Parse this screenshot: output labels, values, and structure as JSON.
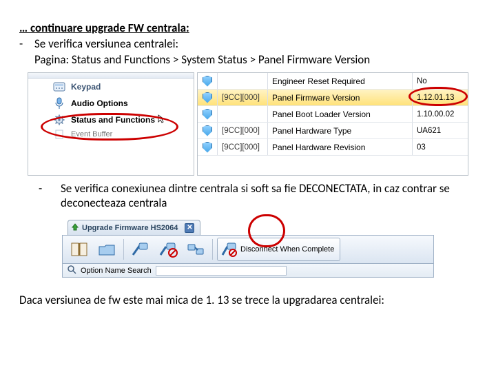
{
  "heading": "… continuare  upgrade FW centrala:",
  "line1": "Se verifica versiunea centralei:",
  "line2": "Pagina: Status and Functions > System Status > Panel Firmware Version",
  "tree": {
    "items": [
      {
        "label": "Keypad"
      },
      {
        "label": "Audio Options"
      },
      {
        "label": "Status and Functions"
      },
      {
        "label": "Event Buffer"
      }
    ]
  },
  "table": {
    "rows": [
      {
        "code": "",
        "label": "Engineer Reset Required",
        "value": "No"
      },
      {
        "code": "[9CC][000]",
        "label": "Panel Firmware Version",
        "value": "1.12.01.13"
      },
      {
        "code": "",
        "label": "Panel Boot Loader Version",
        "value": "1.10.00.02"
      },
      {
        "code": "[9CC][000]",
        "label": "Panel Hardware Type",
        "value": "UA621"
      },
      {
        "code": "[9CC][000]",
        "label": "Panel Hardware Revision",
        "value": "03"
      }
    ]
  },
  "bullet2": "Se verifica conexiunea dintre centrala si soft sa fie DECONECTATA, in caz contrar se deconecteaza centrala",
  "toolbar": {
    "tab": "Upgrade Firmware  HS2064",
    "search_label": "Option Name Search",
    "big_button": "Disconnect When Complete"
  },
  "closing": "Daca versiunea de fw este mai mica de 1. 13 se trece la upgradarea centralei:"
}
